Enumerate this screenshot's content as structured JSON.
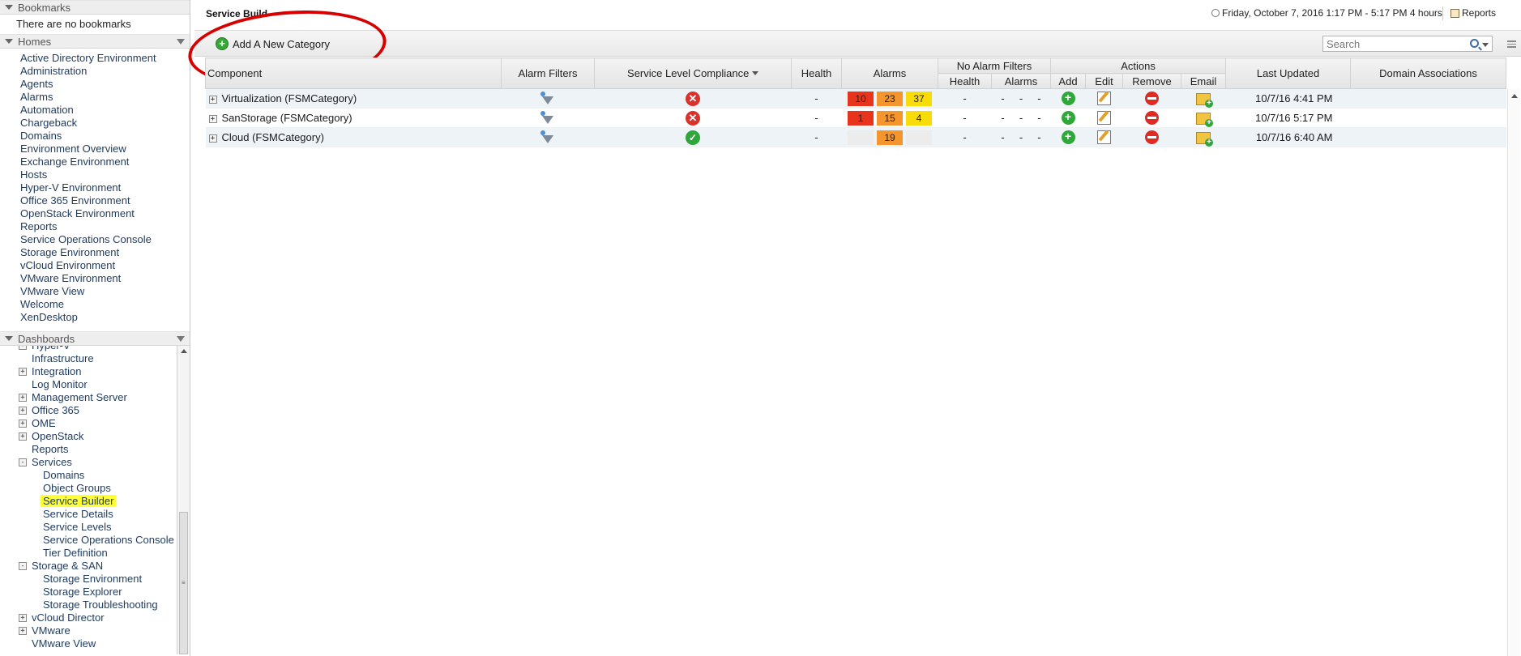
{
  "sidebar": {
    "bookmarks": {
      "title": "Bookmarks",
      "empty_text": "There are no bookmarks"
    },
    "homes": {
      "title": "Homes",
      "items": [
        "Active Directory Environment",
        "Administration",
        "Agents",
        "Alarms",
        "Automation",
        "Chargeback",
        "Domains",
        "Environment Overview",
        "Exchange Environment",
        "Hosts",
        "Hyper-V Environment",
        "Office 365 Environment",
        "OpenStack Environment",
        "Reports",
        "Service Operations Console",
        "Storage Environment",
        "vCloud Environment",
        "VMware Environment",
        "VMware View",
        "Welcome",
        "XenDesktop"
      ]
    },
    "dashboards": {
      "title": "Dashboards",
      "tree": [
        {
          "label": "Hyper-V",
          "level": 1,
          "toggle": "-"
        },
        {
          "label": "Infrastructure",
          "level": 1,
          "toggle": ""
        },
        {
          "label": "Integration",
          "level": 1,
          "toggle": "+"
        },
        {
          "label": "Log Monitor",
          "level": 1,
          "toggle": ""
        },
        {
          "label": "Management Server",
          "level": 1,
          "toggle": "+"
        },
        {
          "label": "Office 365",
          "level": 1,
          "toggle": "+"
        },
        {
          "label": "OME",
          "level": 1,
          "toggle": "+"
        },
        {
          "label": "OpenStack",
          "level": 1,
          "toggle": "+"
        },
        {
          "label": "Reports",
          "level": 1,
          "toggle": ""
        },
        {
          "label": "Services",
          "level": 1,
          "toggle": "-"
        },
        {
          "label": "Domains",
          "level": 2,
          "toggle": ""
        },
        {
          "label": "Object Groups",
          "level": 2,
          "toggle": ""
        },
        {
          "label": "Service Builder",
          "level": 2,
          "toggle": "",
          "selected": true
        },
        {
          "label": "Service Details",
          "level": 2,
          "toggle": ""
        },
        {
          "label": "Service Levels",
          "level": 2,
          "toggle": ""
        },
        {
          "label": "Service Operations Console",
          "level": 2,
          "toggle": ""
        },
        {
          "label": "Tier Definition",
          "level": 2,
          "toggle": ""
        },
        {
          "label": "Storage & SAN",
          "level": 1,
          "toggle": "-"
        },
        {
          "label": "Storage Environment",
          "level": 2,
          "toggle": ""
        },
        {
          "label": "Storage Explorer",
          "level": 2,
          "toggle": ""
        },
        {
          "label": "Storage Troubleshooting",
          "level": 2,
          "toggle": ""
        },
        {
          "label": "vCloud Director",
          "level": 1,
          "toggle": "+"
        },
        {
          "label": "VMware",
          "level": 1,
          "toggle": "+"
        },
        {
          "label": "VMware View",
          "level": 1,
          "toggle": ""
        }
      ]
    }
  },
  "header": {
    "title": "Service Build",
    "time_range": "Friday, October 7, 2016 1:17 PM - 5:17 PM 4 hours",
    "reports_label": "Reports"
  },
  "toolbar": {
    "add_category_label": "Add A New Category",
    "search_placeholder": "Search"
  },
  "table": {
    "columns": {
      "component": "Component",
      "alarm_filters": "Alarm Filters",
      "slc": "Service Level Compliance",
      "health": "Health",
      "alarms": "Alarms",
      "no_alarm_filters": "No Alarm Filters",
      "naf_health": "Health",
      "naf_alarms": "Alarms",
      "actions": "Actions",
      "add": "Add",
      "edit": "Edit",
      "remove": "Remove",
      "email": "Email",
      "last_updated": "Last Updated",
      "domain_associations": "Domain Associations"
    },
    "rows": [
      {
        "component": "Virtualization (FSMCategory)",
        "compliance": "fail",
        "health": "-",
        "alarms": [
          "10",
          "23",
          "37"
        ],
        "naf_health": "-",
        "naf_alarms": [
          "-",
          "-",
          "-"
        ],
        "last_updated": "10/7/16 4:41 PM"
      },
      {
        "component": "SanStorage (FSMCategory)",
        "compliance": "fail",
        "health": "-",
        "alarms": [
          "1",
          "15",
          "4"
        ],
        "naf_health": "-",
        "naf_alarms": [
          "-",
          "-",
          "-"
        ],
        "last_updated": "10/7/16 5:17 PM"
      },
      {
        "component": "Cloud (FSMCategory)",
        "compliance": "ok",
        "health": "-",
        "alarms": [
          "",
          "19",
          ""
        ],
        "naf_health": "-",
        "naf_alarms": [
          "-",
          "-",
          "-"
        ],
        "last_updated": "10/7/16 6:40 AM"
      }
    ]
  },
  "colors": {
    "alarm_critical": "#e8341c",
    "alarm_major": "#f5952e",
    "alarm_warning": "#f8dc0a",
    "highlight": "#ffff33",
    "annotation_circle": "#d70000"
  }
}
